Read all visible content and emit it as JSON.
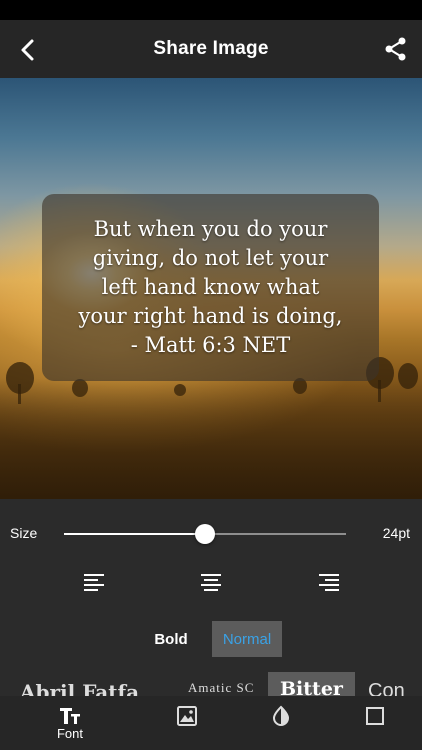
{
  "header": {
    "title": "Share Image",
    "back_icon": "chevron-left-icon",
    "share_icon": "share-icon"
  },
  "preview": {
    "quote_lines": [
      "But when you do your",
      "giving, do not let your",
      "left hand know what",
      "your right hand is doing,",
      "- Matt 6:3 NET"
    ]
  },
  "controls": {
    "size_label": "Size",
    "size_value": "24pt",
    "size_fraction": 0.5,
    "alignment": [
      "align-left",
      "align-center",
      "align-right"
    ],
    "bold_label": "Bold",
    "normal_label": "Normal",
    "selected_weight": "Normal",
    "accent_color": "#3aa2e6"
  },
  "font_strip": {
    "samples": [
      "Abril Fatfa",
      "Amatic SC",
      "Bitter",
      "Con"
    ]
  },
  "tabs": [
    {
      "label": "Font",
      "icon": "text-size-icon"
    },
    {
      "label": "",
      "icon": "image-icon"
    },
    {
      "label": "",
      "icon": "contrast-icon"
    },
    {
      "label": "",
      "icon": "square-icon"
    }
  ]
}
